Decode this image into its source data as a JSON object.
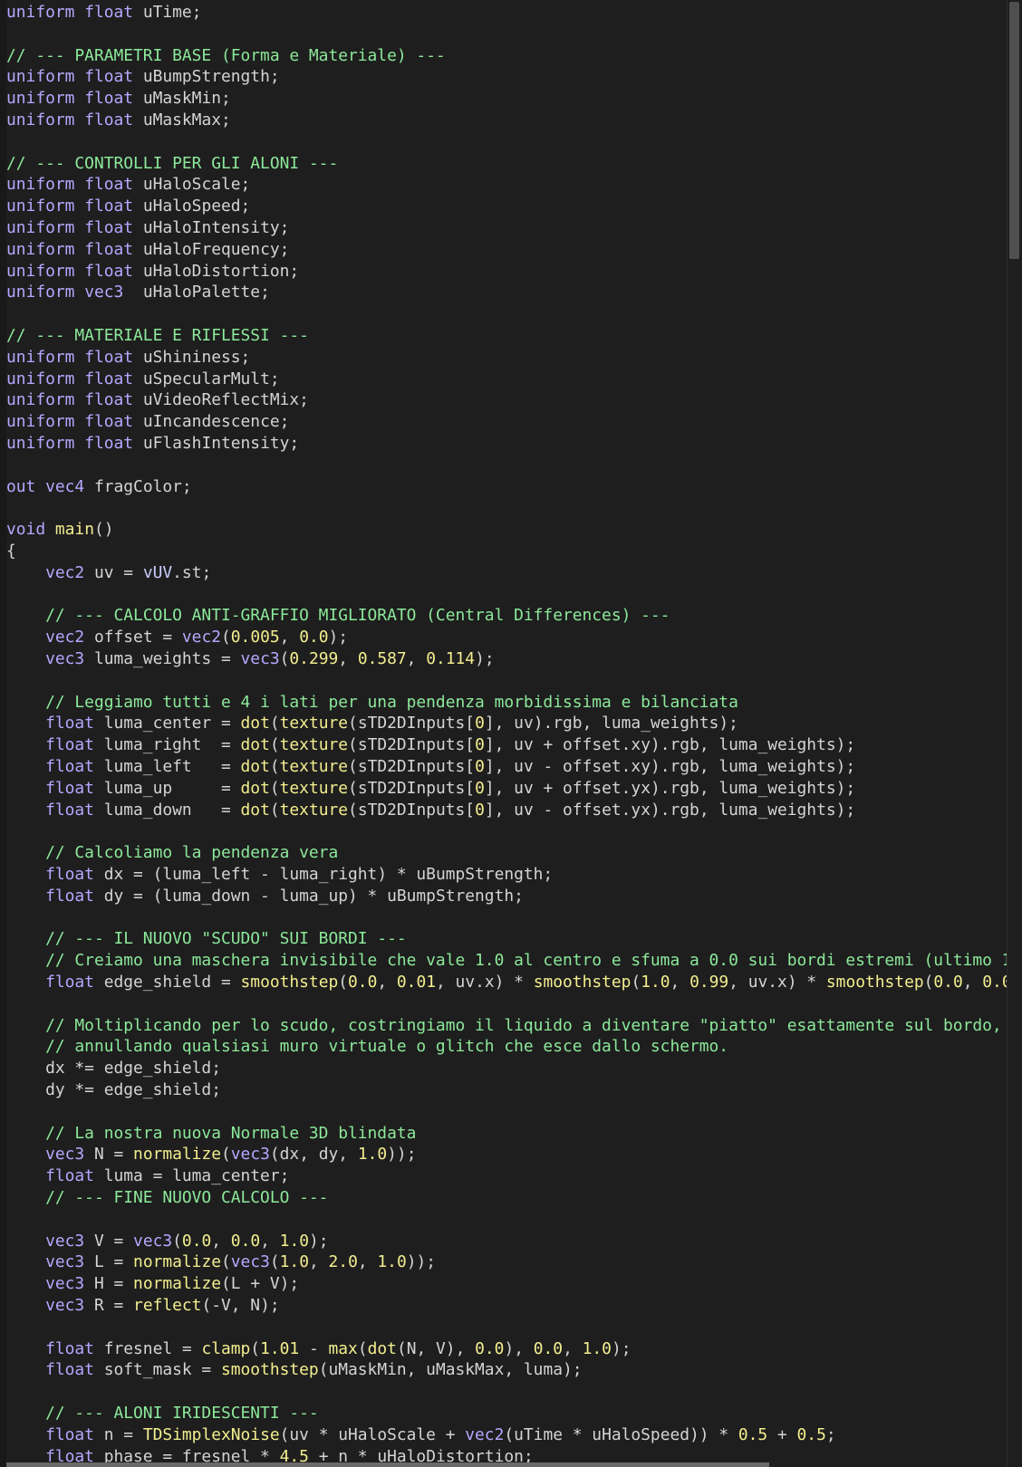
{
  "editor": {
    "language": "glsl",
    "lines": [
      [
        {
          "t": "k",
          "v": "uniform"
        },
        {
          "t": "p",
          "v": " "
        },
        {
          "t": "k",
          "v": "float"
        },
        {
          "t": "p",
          "v": " uTime;"
        }
      ],
      [],
      [
        {
          "t": "c",
          "v": "// --- PARAMETRI BASE (Forma e Materiale) ---"
        }
      ],
      [
        {
          "t": "k",
          "v": "uniform"
        },
        {
          "t": "p",
          "v": " "
        },
        {
          "t": "k",
          "v": "float"
        },
        {
          "t": "p",
          "v": " uBumpStrength;"
        }
      ],
      [
        {
          "t": "k",
          "v": "uniform"
        },
        {
          "t": "p",
          "v": " "
        },
        {
          "t": "k",
          "v": "float"
        },
        {
          "t": "p",
          "v": " uMaskMin;"
        }
      ],
      [
        {
          "t": "k",
          "v": "uniform"
        },
        {
          "t": "p",
          "v": " "
        },
        {
          "t": "k",
          "v": "float"
        },
        {
          "t": "p",
          "v": " uMaskMax;"
        }
      ],
      [],
      [
        {
          "t": "c",
          "v": "// --- CONTROLLI PER GLI ALONI ---"
        }
      ],
      [
        {
          "t": "k",
          "v": "uniform"
        },
        {
          "t": "p",
          "v": " "
        },
        {
          "t": "k",
          "v": "float"
        },
        {
          "t": "p",
          "v": " uHaloScale;"
        }
      ],
      [
        {
          "t": "k",
          "v": "uniform"
        },
        {
          "t": "p",
          "v": " "
        },
        {
          "t": "k",
          "v": "float"
        },
        {
          "t": "p",
          "v": " uHaloSpeed;"
        }
      ],
      [
        {
          "t": "k",
          "v": "uniform"
        },
        {
          "t": "p",
          "v": " "
        },
        {
          "t": "k",
          "v": "float"
        },
        {
          "t": "p",
          "v": " uHaloIntensity;"
        }
      ],
      [
        {
          "t": "k",
          "v": "uniform"
        },
        {
          "t": "p",
          "v": " "
        },
        {
          "t": "k",
          "v": "float"
        },
        {
          "t": "p",
          "v": " uHaloFrequency;"
        }
      ],
      [
        {
          "t": "k",
          "v": "uniform"
        },
        {
          "t": "p",
          "v": " "
        },
        {
          "t": "k",
          "v": "float"
        },
        {
          "t": "p",
          "v": " uHaloDistortion;"
        }
      ],
      [
        {
          "t": "k",
          "v": "uniform"
        },
        {
          "t": "p",
          "v": " "
        },
        {
          "t": "k",
          "v": "vec3"
        },
        {
          "t": "p",
          "v": "  uHaloPalette;"
        }
      ],
      [],
      [
        {
          "t": "c",
          "v": "// --- MATERIALE E RIFLESSI ---"
        }
      ],
      [
        {
          "t": "k",
          "v": "uniform"
        },
        {
          "t": "p",
          "v": " "
        },
        {
          "t": "k",
          "v": "float"
        },
        {
          "t": "p",
          "v": " uShininess;"
        }
      ],
      [
        {
          "t": "k",
          "v": "uniform"
        },
        {
          "t": "p",
          "v": " "
        },
        {
          "t": "k",
          "v": "float"
        },
        {
          "t": "p",
          "v": " uSpecularMult;"
        }
      ],
      [
        {
          "t": "k",
          "v": "uniform"
        },
        {
          "t": "p",
          "v": " "
        },
        {
          "t": "k",
          "v": "float"
        },
        {
          "t": "p",
          "v": " uVideoReflectMix;"
        }
      ],
      [
        {
          "t": "k",
          "v": "uniform"
        },
        {
          "t": "p",
          "v": " "
        },
        {
          "t": "k",
          "v": "float"
        },
        {
          "t": "p",
          "v": " uIncandescence;"
        }
      ],
      [
        {
          "t": "k",
          "v": "uniform"
        },
        {
          "t": "p",
          "v": " "
        },
        {
          "t": "k",
          "v": "float"
        },
        {
          "t": "p",
          "v": " uFlashIntensity;"
        }
      ],
      [],
      [
        {
          "t": "k",
          "v": "out"
        },
        {
          "t": "p",
          "v": " "
        },
        {
          "t": "k",
          "v": "vec4"
        },
        {
          "t": "p",
          "v": " fragColor;"
        }
      ],
      [],
      [
        {
          "t": "k",
          "v": "void"
        },
        {
          "t": "p",
          "v": " "
        },
        {
          "t": "f",
          "v": "main"
        },
        {
          "t": "p",
          "v": "()"
        }
      ],
      [
        {
          "t": "p",
          "v": "{"
        }
      ],
      [
        {
          "t": "p",
          "v": "    "
        },
        {
          "t": "k",
          "v": "vec2"
        },
        {
          "t": "p",
          "v": " uv = "
        },
        {
          "t": "i",
          "v": "vUV"
        },
        {
          "t": "p",
          "v": ".st;"
        }
      ],
      [],
      [
        {
          "t": "p",
          "v": "    "
        },
        {
          "t": "c",
          "v": "// --- CALCOLO ANTI-GRAFFIO MIGLIORATO (Central Differences) ---"
        }
      ],
      [
        {
          "t": "p",
          "v": "    "
        },
        {
          "t": "k",
          "v": "vec2"
        },
        {
          "t": "p",
          "v": " offset = "
        },
        {
          "t": "k",
          "v": "vec2"
        },
        {
          "t": "p",
          "v": "("
        },
        {
          "t": "n",
          "v": "0.005"
        },
        {
          "t": "p",
          "v": ", "
        },
        {
          "t": "n",
          "v": "0.0"
        },
        {
          "t": "p",
          "v": ");"
        }
      ],
      [
        {
          "t": "p",
          "v": "    "
        },
        {
          "t": "k",
          "v": "vec3"
        },
        {
          "t": "p",
          "v": " luma_weights = "
        },
        {
          "t": "k",
          "v": "vec3"
        },
        {
          "t": "p",
          "v": "("
        },
        {
          "t": "n",
          "v": "0.299"
        },
        {
          "t": "p",
          "v": ", "
        },
        {
          "t": "n",
          "v": "0.587"
        },
        {
          "t": "p",
          "v": ", "
        },
        {
          "t": "n",
          "v": "0.114"
        },
        {
          "t": "p",
          "v": ");"
        }
      ],
      [],
      [
        {
          "t": "p",
          "v": "    "
        },
        {
          "t": "c",
          "v": "// Leggiamo tutti e 4 i lati per una pendenza morbidissima e bilanciata"
        }
      ],
      [
        {
          "t": "p",
          "v": "    "
        },
        {
          "t": "k",
          "v": "float"
        },
        {
          "t": "p",
          "v": " luma_center = "
        },
        {
          "t": "f",
          "v": "dot"
        },
        {
          "t": "p",
          "v": "("
        },
        {
          "t": "f",
          "v": "texture"
        },
        {
          "t": "p",
          "v": "(sTD2DInputs["
        },
        {
          "t": "n",
          "v": "0"
        },
        {
          "t": "p",
          "v": "], uv).rgb, luma_weights);"
        }
      ],
      [
        {
          "t": "p",
          "v": "    "
        },
        {
          "t": "k",
          "v": "float"
        },
        {
          "t": "p",
          "v": " luma_right  = "
        },
        {
          "t": "f",
          "v": "dot"
        },
        {
          "t": "p",
          "v": "("
        },
        {
          "t": "f",
          "v": "texture"
        },
        {
          "t": "p",
          "v": "(sTD2DInputs["
        },
        {
          "t": "n",
          "v": "0"
        },
        {
          "t": "p",
          "v": "], uv + offset.xy).rgb, luma_weights);"
        }
      ],
      [
        {
          "t": "p",
          "v": "    "
        },
        {
          "t": "k",
          "v": "float"
        },
        {
          "t": "p",
          "v": " luma_left   = "
        },
        {
          "t": "f",
          "v": "dot"
        },
        {
          "t": "p",
          "v": "("
        },
        {
          "t": "f",
          "v": "texture"
        },
        {
          "t": "p",
          "v": "(sTD2DInputs["
        },
        {
          "t": "n",
          "v": "0"
        },
        {
          "t": "p",
          "v": "], uv - offset.xy).rgb, luma_weights);"
        }
      ],
      [
        {
          "t": "p",
          "v": "    "
        },
        {
          "t": "k",
          "v": "float"
        },
        {
          "t": "p",
          "v": " luma_up     = "
        },
        {
          "t": "f",
          "v": "dot"
        },
        {
          "t": "p",
          "v": "("
        },
        {
          "t": "f",
          "v": "texture"
        },
        {
          "t": "p",
          "v": "(sTD2DInputs["
        },
        {
          "t": "n",
          "v": "0"
        },
        {
          "t": "p",
          "v": "], uv + offset.yx).rgb, luma_weights);"
        }
      ],
      [
        {
          "t": "p",
          "v": "    "
        },
        {
          "t": "k",
          "v": "float"
        },
        {
          "t": "p",
          "v": " luma_down   = "
        },
        {
          "t": "f",
          "v": "dot"
        },
        {
          "t": "p",
          "v": "("
        },
        {
          "t": "f",
          "v": "texture"
        },
        {
          "t": "p",
          "v": "(sTD2DInputs["
        },
        {
          "t": "n",
          "v": "0"
        },
        {
          "t": "p",
          "v": "], uv - offset.yx).rgb, luma_weights);"
        }
      ],
      [],
      [
        {
          "t": "p",
          "v": "    "
        },
        {
          "t": "c",
          "v": "// Calcoliamo la pendenza vera"
        }
      ],
      [
        {
          "t": "p",
          "v": "    "
        },
        {
          "t": "k",
          "v": "float"
        },
        {
          "t": "p",
          "v": " dx = (luma_left - luma_right) * uBumpStrength;"
        }
      ],
      [
        {
          "t": "p",
          "v": "    "
        },
        {
          "t": "k",
          "v": "float"
        },
        {
          "t": "p",
          "v": " dy = (luma_down - luma_up) * uBumpStrength;"
        }
      ],
      [],
      [
        {
          "t": "p",
          "v": "    "
        },
        {
          "t": "c",
          "v": "// --- IL NUOVO \"SCUDO\" SUI BORDI ---"
        }
      ],
      [
        {
          "t": "p",
          "v": "    "
        },
        {
          "t": "c",
          "v": "// Creiamo una maschera invisibile che vale 1.0 al centro e sfuma a 0.0 sui bordi estremi (ultimo 1"
        }
      ],
      [
        {
          "t": "p",
          "v": "    "
        },
        {
          "t": "k",
          "v": "float"
        },
        {
          "t": "p",
          "v": " edge_shield = "
        },
        {
          "t": "f",
          "v": "smoothstep"
        },
        {
          "t": "p",
          "v": "("
        },
        {
          "t": "n",
          "v": "0.0"
        },
        {
          "t": "p",
          "v": ", "
        },
        {
          "t": "n",
          "v": "0.01"
        },
        {
          "t": "p",
          "v": ", uv.x) * "
        },
        {
          "t": "f",
          "v": "smoothstep"
        },
        {
          "t": "p",
          "v": "("
        },
        {
          "t": "n",
          "v": "1.0"
        },
        {
          "t": "p",
          "v": ", "
        },
        {
          "t": "n",
          "v": "0.99"
        },
        {
          "t": "p",
          "v": ", uv.x) * "
        },
        {
          "t": "f",
          "v": "smoothstep"
        },
        {
          "t": "p",
          "v": "("
        },
        {
          "t": "n",
          "v": "0.0"
        },
        {
          "t": "p",
          "v": ", "
        },
        {
          "t": "n",
          "v": "0.0"
        }
      ],
      [],
      [
        {
          "t": "p",
          "v": "    "
        },
        {
          "t": "c",
          "v": "// Moltiplicando per lo scudo, costringiamo il liquido a diventare \"piatto\" esattamente sul bordo,"
        }
      ],
      [
        {
          "t": "p",
          "v": "    "
        },
        {
          "t": "c",
          "v": "// annullando qualsiasi muro virtuale o glitch che esce dallo schermo."
        }
      ],
      [
        {
          "t": "p",
          "v": "    dx *= edge_shield;"
        }
      ],
      [
        {
          "t": "p",
          "v": "    dy *= edge_shield;"
        }
      ],
      [],
      [
        {
          "t": "p",
          "v": "    "
        },
        {
          "t": "c",
          "v": "// La nostra nuova Normale 3D blindata"
        }
      ],
      [
        {
          "t": "p",
          "v": "    "
        },
        {
          "t": "k",
          "v": "vec3"
        },
        {
          "t": "p",
          "v": " N = "
        },
        {
          "t": "f",
          "v": "normalize"
        },
        {
          "t": "p",
          "v": "("
        },
        {
          "t": "k",
          "v": "vec3"
        },
        {
          "t": "p",
          "v": "(dx, dy, "
        },
        {
          "t": "n",
          "v": "1.0"
        },
        {
          "t": "p",
          "v": "));"
        }
      ],
      [
        {
          "t": "p",
          "v": "    "
        },
        {
          "t": "k",
          "v": "float"
        },
        {
          "t": "p",
          "v": " luma = luma_center;"
        }
      ],
      [
        {
          "t": "p",
          "v": "    "
        },
        {
          "t": "c",
          "v": "// --- FINE NUOVO CALCOLO ---"
        }
      ],
      [],
      [
        {
          "t": "p",
          "v": "    "
        },
        {
          "t": "k",
          "v": "vec3"
        },
        {
          "t": "p",
          "v": " V = "
        },
        {
          "t": "k",
          "v": "vec3"
        },
        {
          "t": "p",
          "v": "("
        },
        {
          "t": "n",
          "v": "0.0"
        },
        {
          "t": "p",
          "v": ", "
        },
        {
          "t": "n",
          "v": "0.0"
        },
        {
          "t": "p",
          "v": ", "
        },
        {
          "t": "n",
          "v": "1.0"
        },
        {
          "t": "p",
          "v": ");"
        }
      ],
      [
        {
          "t": "p",
          "v": "    "
        },
        {
          "t": "k",
          "v": "vec3"
        },
        {
          "t": "p",
          "v": " L = "
        },
        {
          "t": "f",
          "v": "normalize"
        },
        {
          "t": "p",
          "v": "("
        },
        {
          "t": "k",
          "v": "vec3"
        },
        {
          "t": "p",
          "v": "("
        },
        {
          "t": "n",
          "v": "1.0"
        },
        {
          "t": "p",
          "v": ", "
        },
        {
          "t": "n",
          "v": "2.0"
        },
        {
          "t": "p",
          "v": ", "
        },
        {
          "t": "n",
          "v": "1.0"
        },
        {
          "t": "p",
          "v": "));"
        }
      ],
      [
        {
          "t": "p",
          "v": "    "
        },
        {
          "t": "k",
          "v": "vec3"
        },
        {
          "t": "p",
          "v": " H = "
        },
        {
          "t": "f",
          "v": "normalize"
        },
        {
          "t": "p",
          "v": "(L + V);"
        }
      ],
      [
        {
          "t": "p",
          "v": "    "
        },
        {
          "t": "k",
          "v": "vec3"
        },
        {
          "t": "p",
          "v": " R = "
        },
        {
          "t": "f",
          "v": "reflect"
        },
        {
          "t": "p",
          "v": "(-V, N);"
        }
      ],
      [],
      [
        {
          "t": "p",
          "v": "    "
        },
        {
          "t": "k",
          "v": "float"
        },
        {
          "t": "p",
          "v": " fresnel = "
        },
        {
          "t": "f",
          "v": "clamp"
        },
        {
          "t": "p",
          "v": "("
        },
        {
          "t": "n",
          "v": "1.01"
        },
        {
          "t": "p",
          "v": " - "
        },
        {
          "t": "f",
          "v": "max"
        },
        {
          "t": "p",
          "v": "("
        },
        {
          "t": "f",
          "v": "dot"
        },
        {
          "t": "p",
          "v": "(N, V), "
        },
        {
          "t": "n",
          "v": "0.0"
        },
        {
          "t": "p",
          "v": "), "
        },
        {
          "t": "n",
          "v": "0.0"
        },
        {
          "t": "p",
          "v": ", "
        },
        {
          "t": "n",
          "v": "1.0"
        },
        {
          "t": "p",
          "v": ");"
        }
      ],
      [
        {
          "t": "p",
          "v": "    "
        },
        {
          "t": "k",
          "v": "float"
        },
        {
          "t": "p",
          "v": " soft_mask = "
        },
        {
          "t": "f",
          "v": "smoothstep"
        },
        {
          "t": "p",
          "v": "(uMaskMin, uMaskMax, luma);"
        }
      ],
      [],
      [
        {
          "t": "p",
          "v": "    "
        },
        {
          "t": "c",
          "v": "// --- ALONI IRIDESCENTI ---"
        }
      ],
      [
        {
          "t": "p",
          "v": "    "
        },
        {
          "t": "k",
          "v": "float"
        },
        {
          "t": "p",
          "v": " n = "
        },
        {
          "t": "f",
          "v": "TDSimplexNoise"
        },
        {
          "t": "p",
          "v": "(uv * uHaloScale + "
        },
        {
          "t": "k",
          "v": "vec2"
        },
        {
          "t": "p",
          "v": "(uTime * uHaloSpeed)) * "
        },
        {
          "t": "n",
          "v": "0.5"
        },
        {
          "t": "p",
          "v": " + "
        },
        {
          "t": "n",
          "v": "0.5"
        },
        {
          "t": "p",
          "v": ";"
        }
      ],
      [
        {
          "t": "p",
          "v": "    "
        },
        {
          "t": "k",
          "v": "float"
        },
        {
          "t": "p",
          "v": " phase = fresnel * "
        },
        {
          "t": "n",
          "v": "4.5"
        },
        {
          "t": "p",
          "v": " + n * uHaloDistortion;"
        }
      ]
    ]
  }
}
